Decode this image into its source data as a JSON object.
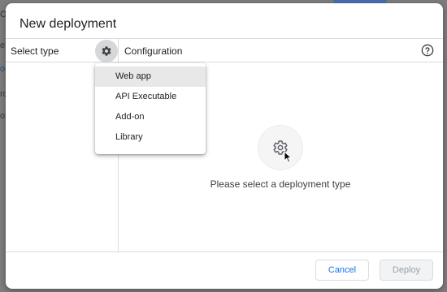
{
  "background": {
    "fragments": [
      "O",
      "e",
      "oc",
      "ro",
      "or"
    ]
  },
  "dialog": {
    "title": "New deployment",
    "left_panel": {
      "label": "Select type",
      "gear_button_icon": "gear-icon"
    },
    "right_panel": {
      "label": "Configuration",
      "help_icon": "help-circle-icon",
      "empty_state": {
        "icon": "gear-icon",
        "message": "Please select a deployment type"
      }
    },
    "footer": {
      "cancel_label": "Cancel",
      "deploy_label": "Deploy"
    }
  },
  "type_menu": {
    "items": [
      {
        "label": "Web app",
        "highlighted": true
      },
      {
        "label": "API Executable",
        "highlighted": false
      },
      {
        "label": "Add-on",
        "highlighted": false
      },
      {
        "label": "Library",
        "highlighted": false
      }
    ]
  },
  "colors": {
    "accent": "#1a73e8",
    "backdrop": "#7d7d7d",
    "divider": "#dadce0",
    "menu_highlight": "#e8e8e9",
    "disabled_text": "#9aa0a6"
  }
}
